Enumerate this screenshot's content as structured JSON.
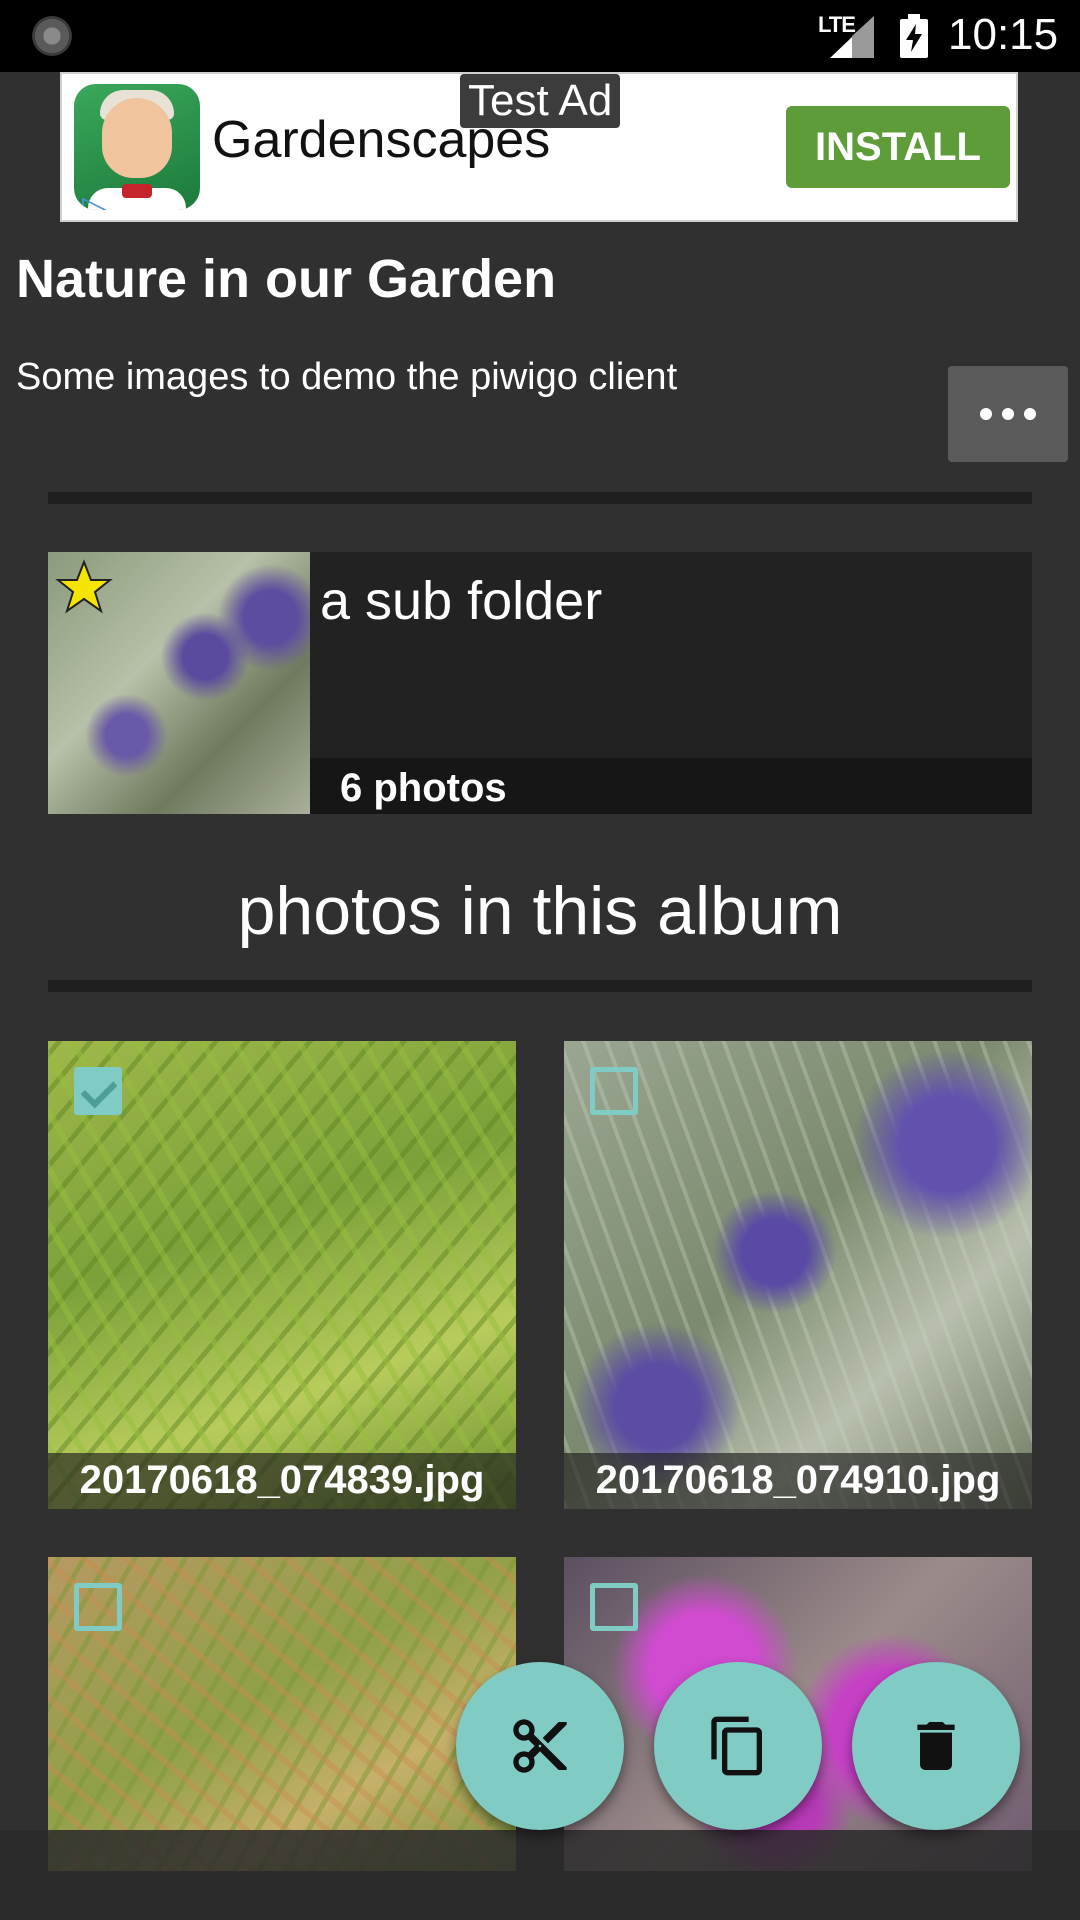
{
  "status_bar": {
    "network": "LTE",
    "time": "10:15"
  },
  "ad": {
    "title": "Gardenscapes",
    "test_label": "Test Ad",
    "install_label": "INSTALL",
    "play_icon": "play-triangle-icon"
  },
  "album": {
    "title": "Nature in our Garden",
    "description": "Some images to demo the piwigo client"
  },
  "sub_album": {
    "name": "a sub folder",
    "count": "6 photos"
  },
  "photos_section": {
    "heading": "photos in this album"
  },
  "photos": [
    {
      "name": "20170618_074839.jpg",
      "checked": true
    },
    {
      "name": "20170618_074910.jpg",
      "checked": false
    },
    {
      "name": "",
      "checked": false
    },
    {
      "name": "",
      "checked": false
    }
  ],
  "actions": {
    "cut_icon": "scissors-icon",
    "copy_icon": "copy-icon",
    "delete_icon": "trash-icon",
    "accent_color": "#80cbc4"
  }
}
